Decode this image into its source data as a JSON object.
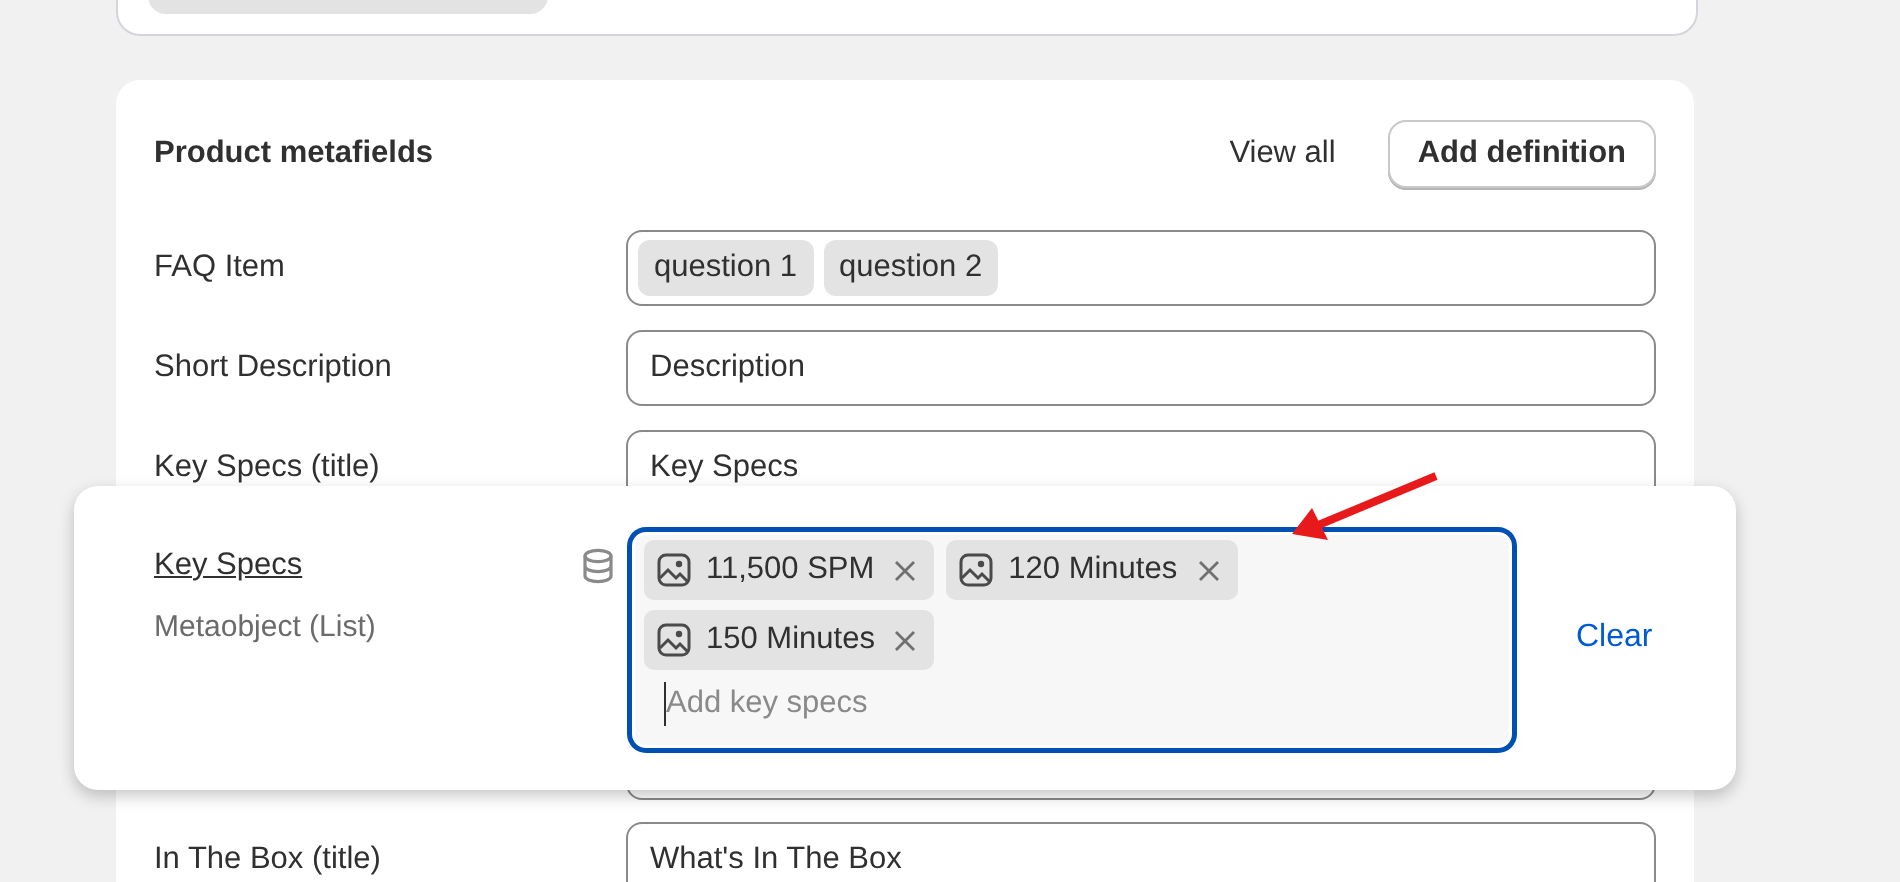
{
  "card": {
    "title": "Product metafields",
    "actions": [
      {
        "kind": "link",
        "label": "View all"
      },
      {
        "kind": "button",
        "label": "Add definition"
      }
    ]
  },
  "rows": [
    {
      "label": "FAQ Item",
      "kind": "tags",
      "tags": [
        "question 1",
        "question 2"
      ]
    },
    {
      "label": "Short Description",
      "kind": "text",
      "value": "Description"
    },
    {
      "label": "Key Specs (title)",
      "kind": "text",
      "value": "Key Specs"
    },
    {
      "kind": "hidden"
    },
    {
      "label": "In The Box (title)",
      "kind": "text",
      "value": "What's In The Box"
    }
  ],
  "popover": {
    "label": "Key Specs",
    "type": "Metaobject (List)",
    "entries": [
      "11,500 SPM",
      "120 Minutes",
      "150 Minutes"
    ],
    "placeholder": "Add key specs",
    "focused": true,
    "action": "Clear"
  }
}
